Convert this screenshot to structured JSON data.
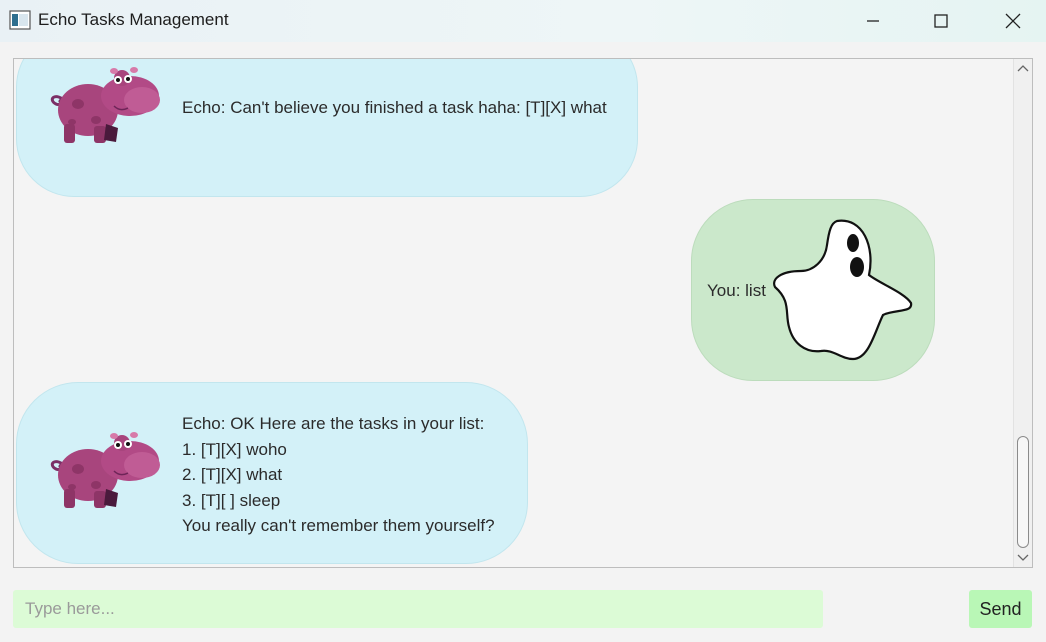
{
  "window": {
    "title": "Echo Tasks Management",
    "icon": "app-window-icon"
  },
  "messages": [
    {
      "sender": "echo",
      "avatar": "hippo-icon",
      "lines": [
        "Echo: Can't believe you finished a task haha: [T][X] what"
      ]
    },
    {
      "sender": "user",
      "avatar": "ghost-icon",
      "lines": [
        "You: list"
      ]
    },
    {
      "sender": "echo",
      "avatar": "hippo-icon",
      "lines": [
        "Echo: OK Here are the tasks in your list:",
        "1. [T][X] woho",
        "2. [T][X] what",
        "3. [T][ ] sleep",
        "You really can't remember them yourself?"
      ]
    }
  ],
  "input": {
    "placeholder": "Type here...",
    "value": ""
  },
  "send_button": {
    "label": "Send"
  },
  "colors": {
    "echo_bubble": "#d3f1f8",
    "user_bubble": "#cbe8cb",
    "input_bg": "#dcfbd6",
    "send_bg": "#b9f7b6"
  }
}
